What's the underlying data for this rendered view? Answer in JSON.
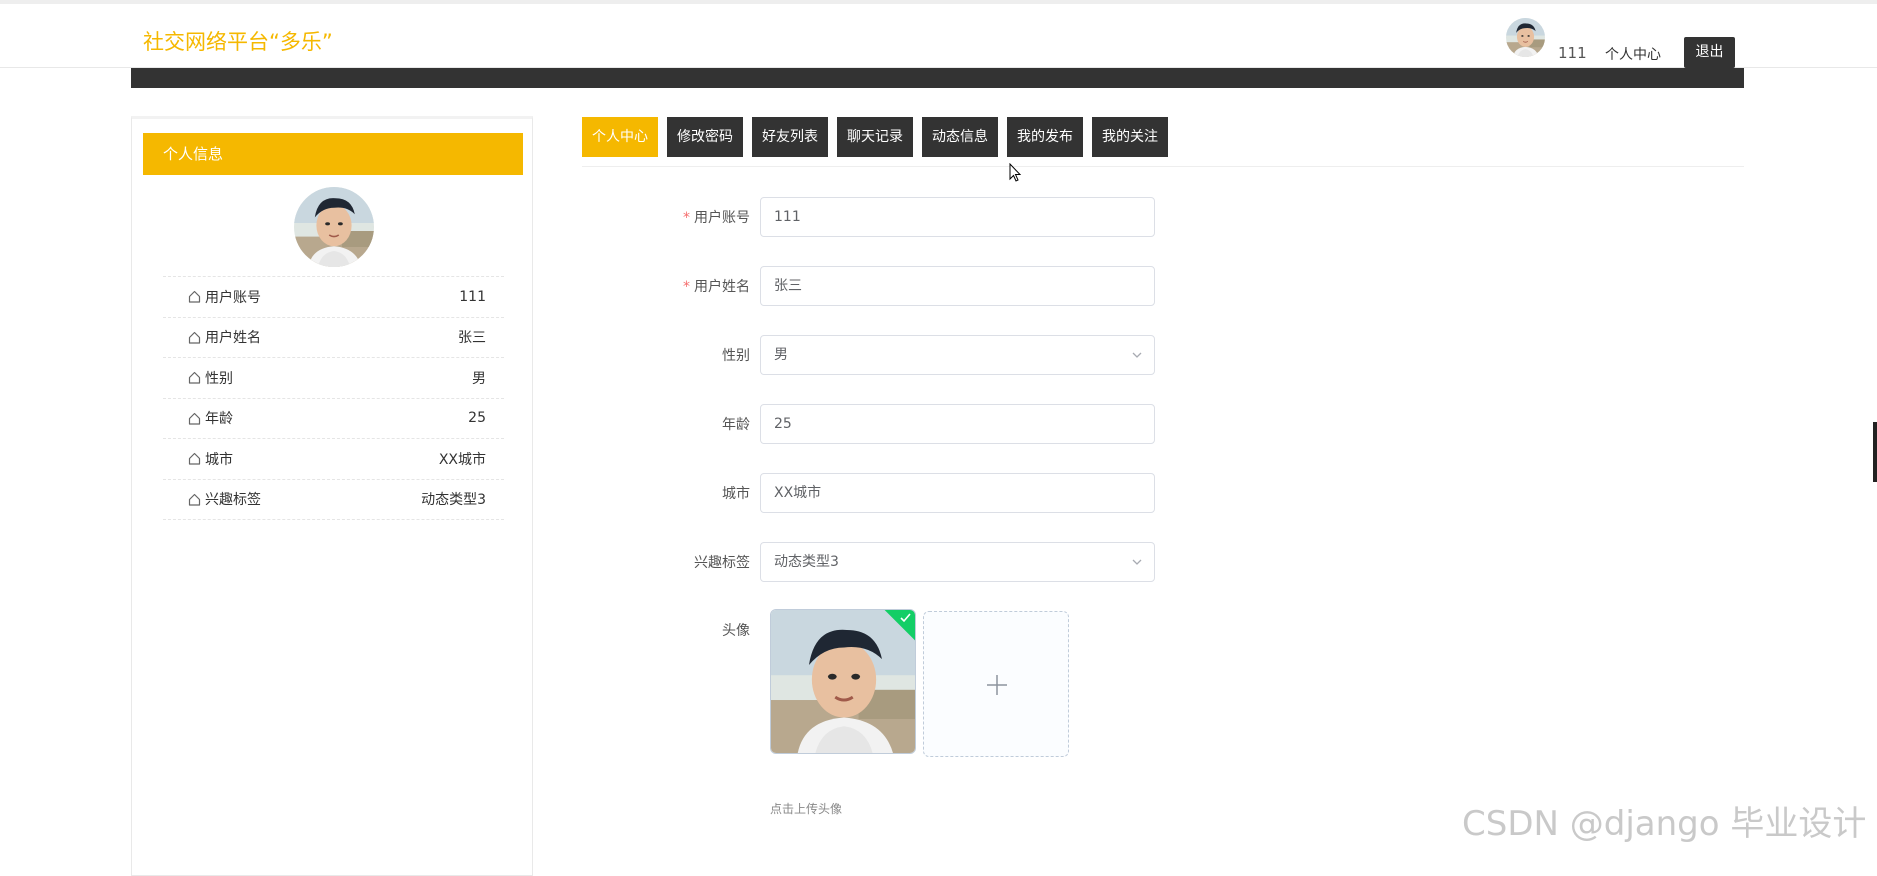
{
  "header": {
    "brand": "社交网络平台“多乐”",
    "username": "111",
    "personal_center": "个人中心",
    "logout": "退出"
  },
  "profile_panel": {
    "title": "个人信息",
    "rows": [
      {
        "key": "用户账号",
        "value": "111"
      },
      {
        "key": "用户姓名",
        "value": "张三"
      },
      {
        "key": "性别",
        "value": "男"
      },
      {
        "key": "年龄",
        "value": "25"
      },
      {
        "key": "城市",
        "value": "XX城市"
      },
      {
        "key": "兴趣标签",
        "value": "动态类型3"
      }
    ]
  },
  "tabs": [
    {
      "label": "个人中心",
      "active": true
    },
    {
      "label": "修改密码",
      "active": false
    },
    {
      "label": "好友列表",
      "active": false
    },
    {
      "label": "聊天记录",
      "active": false
    },
    {
      "label": "动态信息",
      "active": false
    },
    {
      "label": "我的发布",
      "active": false
    },
    {
      "label": "我的关注",
      "active": false
    }
  ],
  "form": {
    "account": {
      "label": "用户账号",
      "value": "111",
      "required": true
    },
    "name": {
      "label": "用户姓名",
      "value": "张三",
      "required": true
    },
    "gender": {
      "label": "性别",
      "value": "男"
    },
    "age": {
      "label": "年龄",
      "value": "25"
    },
    "city": {
      "label": "城市",
      "value": "XX城市"
    },
    "interest": {
      "label": "兴趣标签",
      "value": "动态类型3"
    },
    "avatar": {
      "label": "头像",
      "tip": "点击上传头像"
    }
  },
  "colors": {
    "accent": "#f5b800",
    "dark": "#333333",
    "required": "#f56c6c",
    "upload_success": "#13ce66"
  },
  "watermark": "CSDN @django 毕业设计"
}
